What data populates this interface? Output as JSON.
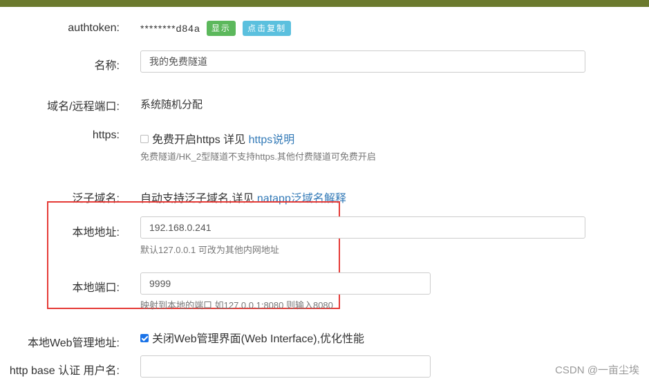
{
  "fields": {
    "authtoken": {
      "label": "authtoken:",
      "value": "********d84a",
      "show_button": "显示",
      "copy_button": "点击复制"
    },
    "name": {
      "label": "名称:",
      "value": "我的免费隧道"
    },
    "domain_port": {
      "label": "域名/远程端口:",
      "value": "系统随机分配"
    },
    "https": {
      "label": "https:",
      "checkbox_text": "免费开启https 详见",
      "link": "https说明",
      "checked": false,
      "help": "免费隧道/HK_2型隧道不支持https.其他付费隧道可免费开启"
    },
    "wildcard": {
      "label": "泛子域名:",
      "text": "自动支持泛子域名,详见",
      "link": "natapp泛域名解释"
    },
    "local_address": {
      "label": "本地地址:",
      "value": "192.168.0.241",
      "help": "默认127.0.0.1 可改为其他内网地址"
    },
    "local_port": {
      "label": "本地端口:",
      "value": "9999",
      "help": "映射到本地的端口 如127.0.0.1:8080 则输入8080"
    },
    "web_manage": {
      "label": "本地Web管理地址:",
      "checkbox_text": "关闭Web管理界面(Web Interface),优化性能",
      "checked": true
    },
    "http_auth_user": {
      "label": "http base 认证 用户名:",
      "value": ""
    }
  },
  "watermark": "CSDN @一亩尘埃",
  "colors": {
    "top_bar": "#6b7a2e",
    "highlight_box": "#e53935",
    "link": "#337ab7",
    "green_button": "#5cb85c",
    "blue_button": "#5bc0de"
  }
}
